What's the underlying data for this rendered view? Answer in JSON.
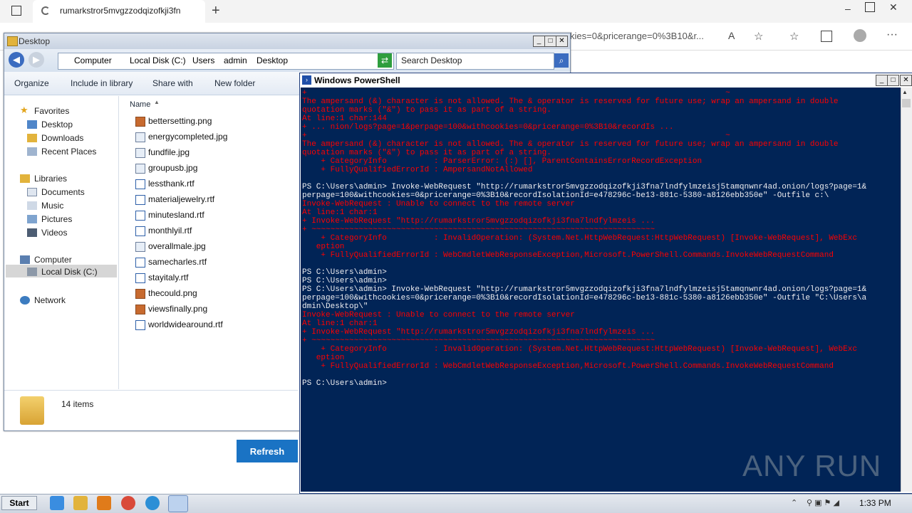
{
  "browser": {
    "tab_title": "rumarkstror5mvgzzodqizofkji3fn",
    "url_fragment": "kies=0&pricerange=0%3B10&r...",
    "new_tab_label": "+"
  },
  "explorer": {
    "title": "Desktop",
    "breadcrumb": [
      "Computer",
      "Local Disk (C:)",
      "Users",
      "admin",
      "Desktop"
    ],
    "search_placeholder": "Search Desktop",
    "toolbar": {
      "organize": "Organize",
      "include_in_library": "Include in library",
      "share_with": "Share with",
      "new_folder": "New folder"
    },
    "nav": {
      "favorites": "Favorites",
      "favorites_items": [
        "Desktop",
        "Downloads",
        "Recent Places"
      ],
      "libraries": "Libraries",
      "libraries_items": [
        "Documents",
        "Music",
        "Pictures",
        "Videos"
      ],
      "computer": "Computer",
      "computer_items": [
        "Local Disk (C:)"
      ],
      "network": "Network"
    },
    "column_name": "Name",
    "files": [
      {
        "name": "bettersetting.png",
        "type": "png"
      },
      {
        "name": "energycompleted.jpg",
        "type": "jpg"
      },
      {
        "name": "fundfile.jpg",
        "type": "jpg"
      },
      {
        "name": "groupusb.jpg",
        "type": "jpg"
      },
      {
        "name": "lessthank.rtf",
        "type": "rtf"
      },
      {
        "name": "materialjewelry.rtf",
        "type": "rtf"
      },
      {
        "name": "minutesland.rtf",
        "type": "rtf"
      },
      {
        "name": "monthlyil.rtf",
        "type": "rtf"
      },
      {
        "name": "overallmale.jpg",
        "type": "jpg"
      },
      {
        "name": "samecharles.rtf",
        "type": "rtf"
      },
      {
        "name": "stayitaly.rtf",
        "type": "rtf"
      },
      {
        "name": "thecould.png",
        "type": "png"
      },
      {
        "name": "viewsfinally.png",
        "type": "png"
      },
      {
        "name": "worldwidearound.rtf",
        "type": "rtf"
      }
    ],
    "status": "14 items"
  },
  "refresh_label": "Refresh",
  "powershell": {
    "title": "Windows PowerShell",
    "lines": [
      {
        "t": "+                                                                                         ~",
        "c": "err"
      },
      {
        "t": "The ampersand (&) character is not allowed. The & operator is reserved for future use; wrap an ampersand in double",
        "c": "err"
      },
      {
        "t": "quotation marks (\"&\") to pass it as part of a string.",
        "c": "err"
      },
      {
        "t": "At line:1 char:144",
        "c": "err"
      },
      {
        "t": "+ ... nion/logs?page=1&perpage=100&withcookies=0&pricerange=0%3B10&recordIs ...",
        "c": "err"
      },
      {
        "t": "+                                                                                         ~",
        "c": "err"
      },
      {
        "t": "The ampersand (&) character is not allowed. The & operator is reserved for future use; wrap an ampersand in double",
        "c": "err"
      },
      {
        "t": "quotation marks (\"&\") to pass it as part of a string.",
        "c": "err"
      },
      {
        "t": "    + CategoryInfo          : ParserError: (:) [], ParentContainsErrorRecordException",
        "c": "err"
      },
      {
        "t": "    + FullyQualifiedErrorId : AmpersandNotAllowed",
        "c": "err"
      },
      {
        "t": "",
        "c": "std"
      },
      {
        "t": "PS C:\\Users\\admin> Invoke-WebRequest \"http://rumarkstror5mvgzzodqizofkji3fna7lndfylmzeisj5tamqnwnr4ad.onion/logs?page=1&",
        "c": "std"
      },
      {
        "t": "perpage=100&withcookies=0&pricerange=0%3B10&recordIsolationId=e478296c-be13-881c-5380-a8126ebb350e\" -Outfile c:\\",
        "c": "std"
      },
      {
        "t": "Invoke-WebRequest : Unable to connect to the remote server",
        "c": "err"
      },
      {
        "t": "At line:1 char:1",
        "c": "err"
      },
      {
        "t": "+ Invoke-WebRequest \"http://rumarkstror5mvgzzodqizofkji3fna7lndfylmzeis ...",
        "c": "err"
      },
      {
        "t": "+ ~~~~~~~~~~~~~~~~~~~~~~~~~~~~~~~~~~~~~~~~~~~~~~~~~~~~~~~~~~~~~~~~~~~~~~~~~",
        "c": "err"
      },
      {
        "t": "    + CategoryInfo          : InvalidOperation: (System.Net.HttpWebRequest:HttpWebRequest) [Invoke-WebRequest], WebExc",
        "c": "err"
      },
      {
        "t": "   eption",
        "c": "err"
      },
      {
        "t": "    + FullyQualifiedErrorId : WebCmdletWebResponseException,Microsoft.PowerShell.Commands.InvokeWebRequestCommand",
        "c": "err"
      },
      {
        "t": "",
        "c": "std"
      },
      {
        "t": "PS C:\\Users\\admin>",
        "c": "std"
      },
      {
        "t": "PS C:\\Users\\admin>",
        "c": "std"
      },
      {
        "t": "PS C:\\Users\\admin> Invoke-WebRequest \"http://rumarkstror5mvgzzodqizofkji3fna7lndfylmzeisj5tamqnwnr4ad.onion/logs?page=1&",
        "c": "std"
      },
      {
        "t": "perpage=100&withcookies=0&pricerange=0%3B10&recordIsolationId=e478296c-be13-881c-5380-a8126ebb350e\" -Outfile \"C:\\Users\\a",
        "c": "std"
      },
      {
        "t": "dmin\\Desktop\\\"",
        "c": "std"
      },
      {
        "t": "Invoke-WebRequest : Unable to connect to the remote server",
        "c": "err"
      },
      {
        "t": "At line:1 char:1",
        "c": "err"
      },
      {
        "t": "+ Invoke-WebRequest \"http://rumarkstror5mvgzzodqizofkji3fna7lndfylmzeis ...",
        "c": "err"
      },
      {
        "t": "+ ~~~~~~~~~~~~~~~~~~~~~~~~~~~~~~~~~~~~~~~~~~~~~~~~~~~~~~~~~~~~~~~~~~~~~~~~~",
        "c": "err"
      },
      {
        "t": "    + CategoryInfo          : InvalidOperation: (System.Net.HttpWebRequest:HttpWebRequest) [Invoke-WebRequest], WebExc",
        "c": "err"
      },
      {
        "t": "   eption",
        "c": "err"
      },
      {
        "t": "    + FullyQualifiedErrorId : WebCmdletWebResponseException,Microsoft.PowerShell.Commands.InvokeWebRequestCommand",
        "c": "err"
      },
      {
        "t": "",
        "c": "std"
      },
      {
        "t": "PS C:\\Users\\admin>",
        "c": "std"
      }
    ]
  },
  "watermark": "ANY RUN",
  "taskbar": {
    "start_label": "Start",
    "clock": "1:33 PM"
  }
}
